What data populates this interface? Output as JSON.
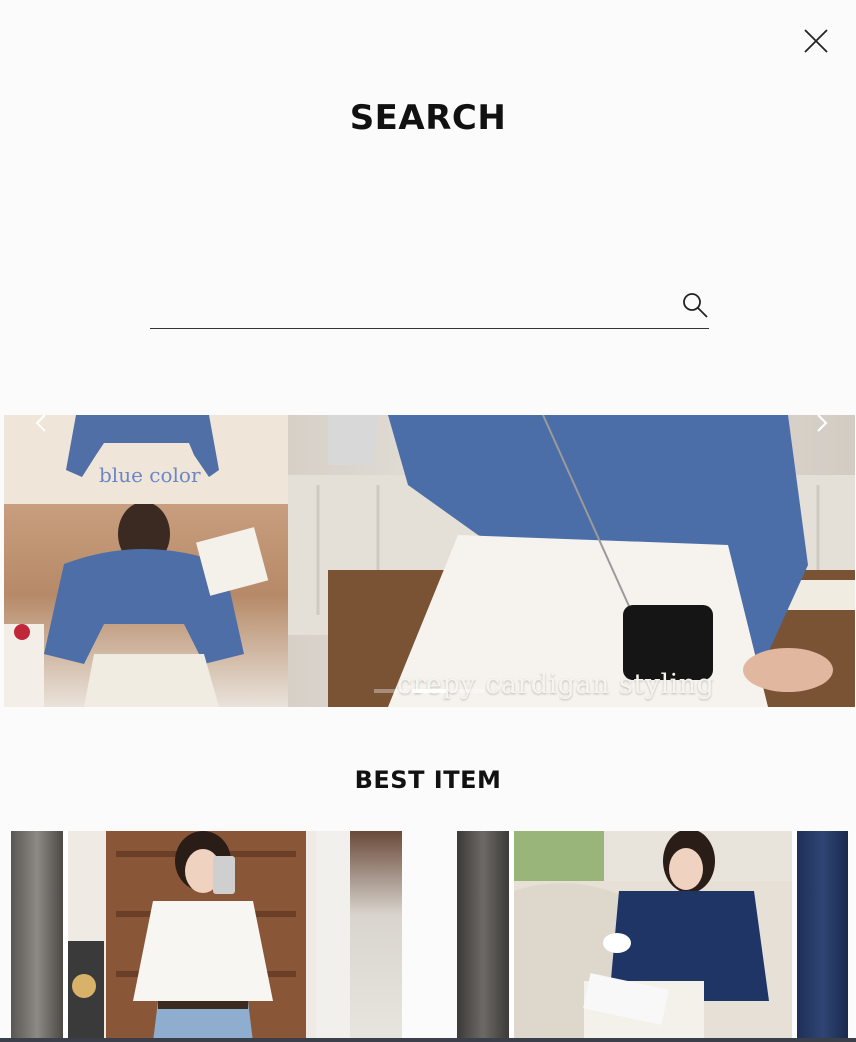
{
  "header": {
    "title": "SEARCH",
    "close_icon": "close-icon"
  },
  "search": {
    "value": "",
    "placeholder": "",
    "icon": "search-icon"
  },
  "banner": {
    "label": "blue color",
    "caption": "crepy cardigan styling",
    "prev_icon": "chevron-left-icon",
    "next_icon": "chevron-right-icon",
    "dots": 3,
    "active_dot": 1
  },
  "best_item": {
    "title": "BEST ITEM",
    "products": [
      {
        "image": "white blouse with jeans"
      },
      {
        "image": "navy blouse on sofa"
      }
    ]
  },
  "colors": {
    "accent_blue": "#4a6fa5",
    "text": "#111111",
    "background": "#fbfbfb"
  }
}
